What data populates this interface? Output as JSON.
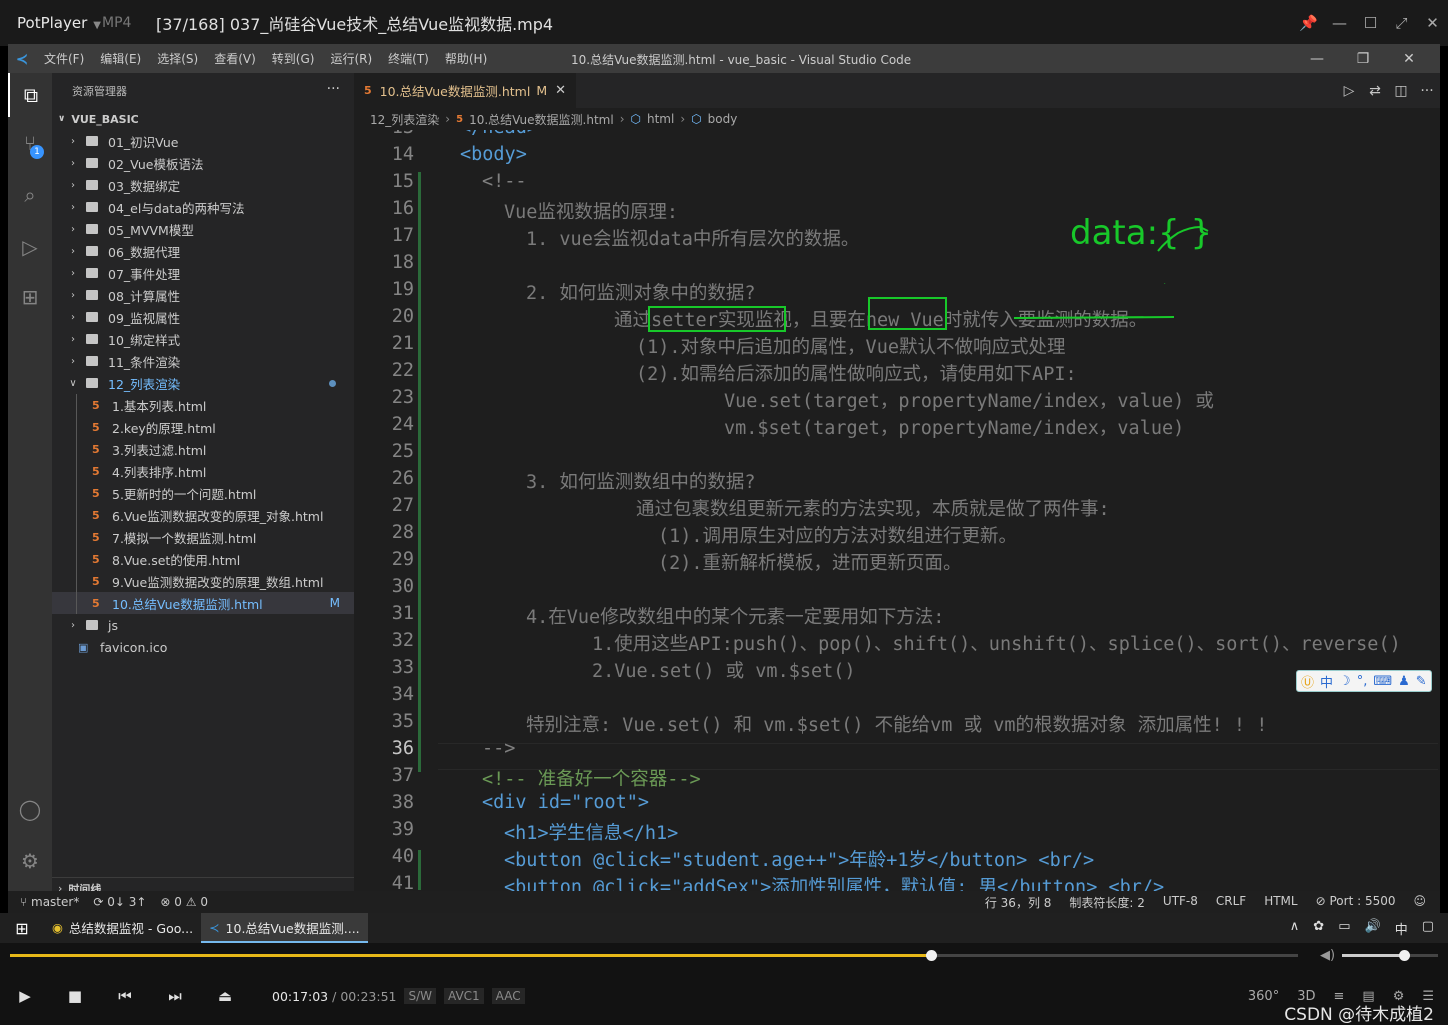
{
  "player": {
    "app_name": "PotPlayer",
    "format": "MP4",
    "title": "[37/168] 037_尚硅谷Vue技术_总结Vue监视数据.mp4",
    "time_current": "00:17:03",
    "time_sep": "/",
    "time_total": "00:23:51",
    "chips": [
      "S/W",
      "AVC1",
      "AAC"
    ],
    "progress_fraction": 0.715,
    "volume_fraction": 0.65,
    "right_labels": [
      "360°",
      "3D"
    ]
  },
  "vscode": {
    "menu": [
      "文件(F)",
      "编辑(E)",
      "选择(S)",
      "查看(V)",
      "转到(G)",
      "运行(R)",
      "终端(T)",
      "帮助(H)"
    ],
    "window_title": "10.总结Vue数据监测.html - vue_basic - Visual Studio Code",
    "explorer_title": "资源管理器",
    "project": "VUE_BASIC",
    "tree": [
      {
        "label": "01_初识Vue",
        "type": "folder"
      },
      {
        "label": "02_Vue模板语法",
        "type": "folder"
      },
      {
        "label": "03_数据绑定",
        "type": "folder"
      },
      {
        "label": "04_el与data的两种写法",
        "type": "folder"
      },
      {
        "label": "05_MVVM模型",
        "type": "folder"
      },
      {
        "label": "06_数据代理",
        "type": "folder"
      },
      {
        "label": "07_事件处理",
        "type": "folder"
      },
      {
        "label": "08_计算属性",
        "type": "folder"
      },
      {
        "label": "09_监视属性",
        "type": "folder"
      },
      {
        "label": "10_绑定样式",
        "type": "folder"
      },
      {
        "label": "11_条件渲染",
        "type": "folder"
      },
      {
        "label": "12_列表渲染",
        "type": "folder-open"
      },
      {
        "label": "1.基本列表.html",
        "type": "file"
      },
      {
        "label": "2.key的原理.html",
        "type": "file"
      },
      {
        "label": "3.列表过滤.html",
        "type": "file"
      },
      {
        "label": "4.列表排序.html",
        "type": "file"
      },
      {
        "label": "5.更新时的一个问题.html",
        "type": "file"
      },
      {
        "label": "6.Vue监测数据改变的原理_对象.html",
        "type": "file"
      },
      {
        "label": "7.模拟一个数据监测.html",
        "type": "file"
      },
      {
        "label": "8.Vue.set的使用.html",
        "type": "file"
      },
      {
        "label": "9.Vue监测数据改变的原理_数组.html",
        "type": "file"
      },
      {
        "label": "10.总结Vue数据监测.html",
        "type": "file-selected",
        "flag": "M"
      },
      {
        "label": "js",
        "type": "folder"
      },
      {
        "label": "favicon.ico",
        "type": "ico"
      }
    ],
    "timeline": "时间线",
    "tab_label": "10.总结Vue数据监测.html",
    "tab_flag": "M",
    "breadcrumbs": [
      "12_列表渲染",
      "10.总结Vue数据监测.html",
      "html",
      "body"
    ],
    "code_lines": [
      {
        "n": "13",
        "t": "</head>"
      },
      {
        "n": "14",
        "t": "<body>"
      },
      {
        "n": "15",
        "t": "<!--"
      },
      {
        "n": "16",
        "t": "Vue监视数据的原理:"
      },
      {
        "n": "17",
        "t": "1. vue会监视data中所有层次的数据。"
      },
      {
        "n": "18",
        "t": ""
      },
      {
        "n": "19",
        "t": "2. 如何监测对象中的数据?"
      },
      {
        "n": "20",
        "t": "通过setter实现监视，且要在new Vue时就传入要监测的数据。"
      },
      {
        "n": "21",
        "t": "(1).对象中后追加的属性，Vue默认不做响应式处理"
      },
      {
        "n": "22",
        "t": "(2).如需给后添加的属性做响应式，请使用如下API:"
      },
      {
        "n": "23",
        "t": "Vue.set(target，propertyName/index，value) 或"
      },
      {
        "n": "24",
        "t": "vm.$set(target，propertyName/index，value)"
      },
      {
        "n": "25",
        "t": ""
      },
      {
        "n": "26",
        "t": "3. 如何监测数组中的数据?"
      },
      {
        "n": "27",
        "t": "通过包裹数组更新元素的方法实现，本质就是做了两件事:"
      },
      {
        "n": "28",
        "t": "(1).调用原生对应的方法对数组进行更新。"
      },
      {
        "n": "29",
        "t": "(2).重新解析模板，进而更新页面。"
      },
      {
        "n": "30",
        "t": ""
      },
      {
        "n": "31",
        "t": "4.在Vue修改数组中的某个元素一定要用如下方法:"
      },
      {
        "n": "32",
        "t": "1.使用这些API:push()、pop()、shift()、unshift()、splice()、sort()、reverse()"
      },
      {
        "n": "33",
        "t": "2.Vue.set() 或 vm.$set()"
      },
      {
        "n": "34",
        "t": ""
      },
      {
        "n": "35",
        "t": "特别注意: Vue.set() 和 vm.$set() 不能给vm 或 vm的根数据对象 添加属性! ! !"
      },
      {
        "n": "36",
        "t": "-->"
      },
      {
        "n": "37",
        "t": "<!-- 准备好一个容器-->"
      },
      {
        "n": "38",
        "t": "<div id=\"root\">"
      },
      {
        "n": "39",
        "t": "<h1>学生信息</h1>"
      },
      {
        "n": "40",
        "t": "<button @click=\"student.age++\">年龄+1岁</button> <br/>"
      },
      {
        "n": "41",
        "t": "<button @click=\"addSex\">添加性别属性，默认值: 男</button> <br/>"
      }
    ],
    "annotation": "data:{ }",
    "ime": "中",
    "status": {
      "branch": "master*",
      "sync": "0↓ 3↑",
      "problems": "⊗ 0 ⚠ 0",
      "position": "行 36，列 8",
      "tabsize": "制表符长度: 2",
      "encoding": "UTF-8",
      "eol": "CRLF",
      "lang": "HTML",
      "port": "Port : 5500"
    }
  },
  "taskbar": {
    "items": [
      {
        "label": "总结数据监视 - Goo..."
      },
      {
        "label": "10.总结Vue数据监测...."
      }
    ],
    "ime": "中"
  },
  "watermark": "CSDN @待木成植2",
  "colors": {
    "accent_green": "#18c82a",
    "progress": "#e7b818",
    "vscode_blue": "#3a96dd"
  }
}
